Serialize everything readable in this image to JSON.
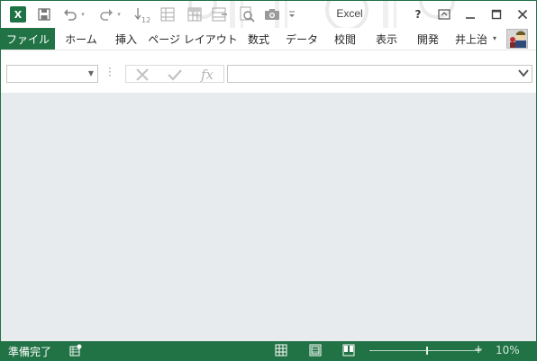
{
  "window": {
    "title": "Excel",
    "app_icon_letter": "X"
  },
  "quick_access": {
    "items": [
      "save-icon",
      "undo-icon",
      "redo-icon",
      "sort-icon",
      "freeze-panes-icon",
      "table-icon",
      "insert-rows-icon",
      "print-preview-icon",
      "camera-icon",
      "customize-qat-icon"
    ],
    "sort_badge": "12"
  },
  "window_controls": {
    "help": "?",
    "ribbon_display": "ribbon-display-icon",
    "minimize": "minimize-icon",
    "maximize": "maximize-icon",
    "close": "close-icon"
  },
  "ribbon": {
    "file_tab": "ファイル",
    "tabs": [
      "ホーム",
      "挿入",
      "ページ レイアウト",
      "数式",
      "データ",
      "校閲",
      "表示",
      "開発"
    ],
    "user_name": "井上治"
  },
  "formula_bar": {
    "name_box_value": "",
    "formula_value": "",
    "fx_label": "fx"
  },
  "status_bar": {
    "status": "準備完了",
    "zoom_minus": "-",
    "zoom_plus": "+",
    "zoom_level": "10%",
    "zoom_fraction": 0.1
  },
  "colors": {
    "accent": "#217346",
    "workspace": "#e8ebee"
  }
}
